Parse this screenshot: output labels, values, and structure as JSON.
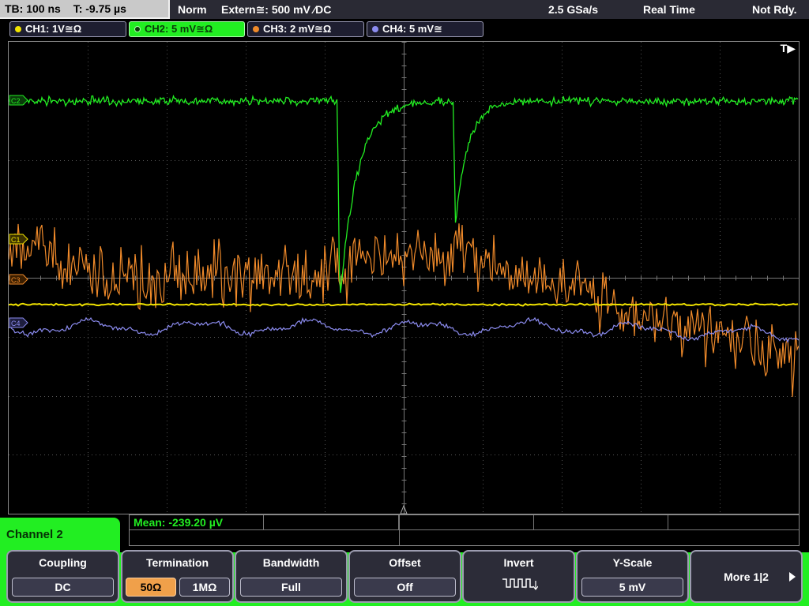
{
  "header": {
    "timebase": "TB: 100 ns",
    "trigger_time": "T: -9.75 µs",
    "mode": "Norm",
    "trigger_source": "Extern≅: 500 mV ⁄DC",
    "sample_rate": "2.5 GSa/s",
    "acq_mode": "Real Time",
    "status": "Not Rdy."
  },
  "channels": [
    {
      "label": "CH1: 1V≅Ω",
      "color": "#f2e400",
      "active": false
    },
    {
      "label": "CH2: 5 mV≅Ω",
      "color": "#22ee22",
      "active": true
    },
    {
      "label": "CH3: 2 mV≅Ω",
      "color": "#f08a2a",
      "active": false
    },
    {
      "label": "CH4: 5 mV≅",
      "color": "#8c8cf0",
      "active": false
    }
  ],
  "display": {
    "trigger_marker": "T▶",
    "markers": {
      "ch2": "C2",
      "ch1": "C1",
      "ch3": "C3",
      "ch4": "C4"
    }
  },
  "measurement": {
    "mean": "Mean: -239.20 µV"
  },
  "menu": {
    "title": "Channel 2",
    "softkeys": {
      "coupling": {
        "title": "Coupling",
        "value": "DC"
      },
      "termination": {
        "title": "Termination",
        "options": [
          "50Ω",
          "1MΩ"
        ],
        "selected": "50Ω"
      },
      "bandwidth": {
        "title": "Bandwidth",
        "value": "Full"
      },
      "offset": {
        "title": "Offset",
        "value": "Off"
      },
      "invert": {
        "title": "Invert",
        "icon": "inverted-square-wave-icon"
      },
      "yscale": {
        "title": "Y-Scale",
        "value": "5 mV"
      },
      "more": {
        "title": "More 1|2"
      }
    }
  }
}
